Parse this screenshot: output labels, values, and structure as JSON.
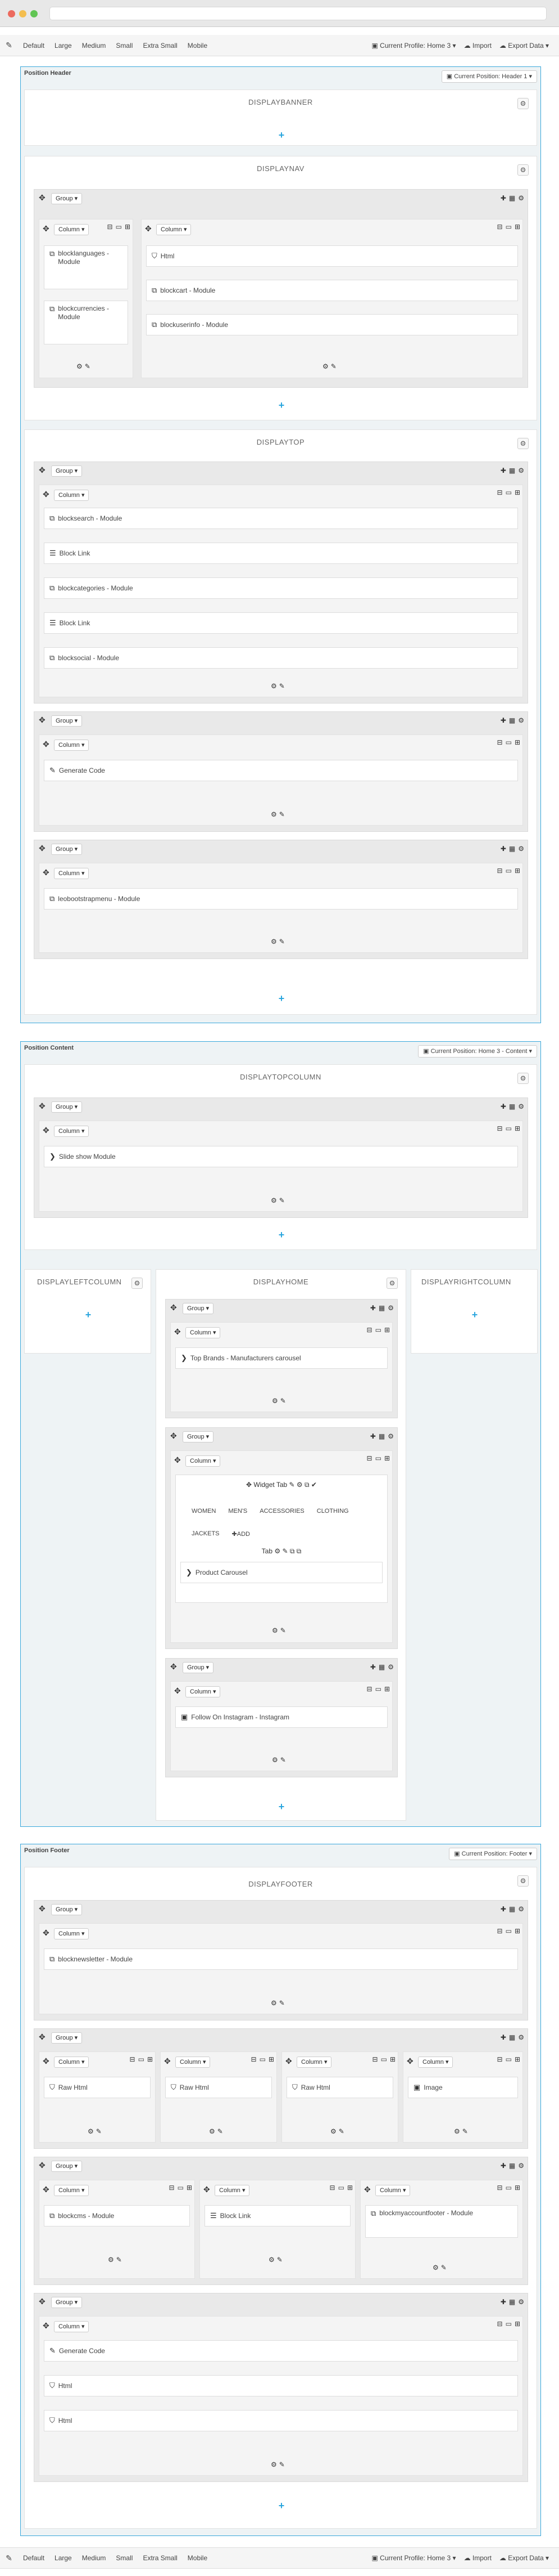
{
  "toolbar": {
    "sizes": [
      "Default",
      "Large",
      "Medium",
      "Small",
      "Extra Small",
      "Mobile"
    ],
    "profile": "Current Profile: Home 3",
    "import": "Import",
    "export": "Export Data"
  },
  "header": {
    "title": "Position Header",
    "position_btn": "Current Position: Header 1"
  },
  "content": {
    "title": "Position Content",
    "position_btn": "Current Position: Home 3 - Content"
  },
  "footer": {
    "title": "Position Footer",
    "position_btn": "Current Position: Footer"
  },
  "labels": {
    "group": "Group",
    "column": "Column"
  },
  "hooks": {
    "displaybanner": "DISPLAYBANNER",
    "displaynav": "DISPLAYNAV",
    "displaytop": "DISPLAYTOP",
    "displaytopcolumn": "DISPLAYTOPCOLUMN",
    "displayleftcolumn": "DISPLAYLEFTCOLUMN",
    "displayhome": "DISPLAYHOME",
    "displayrightcolumn": "DISPLAYRIGHTCOLUMN",
    "displayfooter": "DISPLAYFOOTER"
  },
  "items": {
    "blocklanguages": "blocklanguages - Module",
    "blockcurrencies": "blockcurrencies - Module",
    "html": "Html",
    "blockcart": "blockcart - Module",
    "blockuserinfo": "blockuserinfo - Module",
    "blocksearch": "blocksearch - Module",
    "blocklink": "Block Link",
    "blockcategories": "blockcategories - Module",
    "blocksocial": "blocksocial - Module",
    "generatecode": "Generate Code",
    "leobootstrapmenu": "leobootstrapmenu - Module",
    "slideshow": "Slide show Module",
    "topbrands": "Top Brands - Manufacturers carousel",
    "widgettab": "Widget Tab",
    "addlabel": "ADD",
    "tab": "Tab",
    "productcarousel": "Product Carousel",
    "instagram": "Follow On Instagram - Instagram",
    "blocknewsletter": "blocknewsletter - Module",
    "rawhtml": "Raw Html",
    "image": "Image",
    "blockcms": "blockcms - Module",
    "blockmyaccountfooter": "blockmyaccountfooter - Module"
  },
  "tabs": [
    "WOMEN",
    "MEN'S",
    "ACCESSORIES",
    "CLOTHING",
    "JACKETS"
  ]
}
